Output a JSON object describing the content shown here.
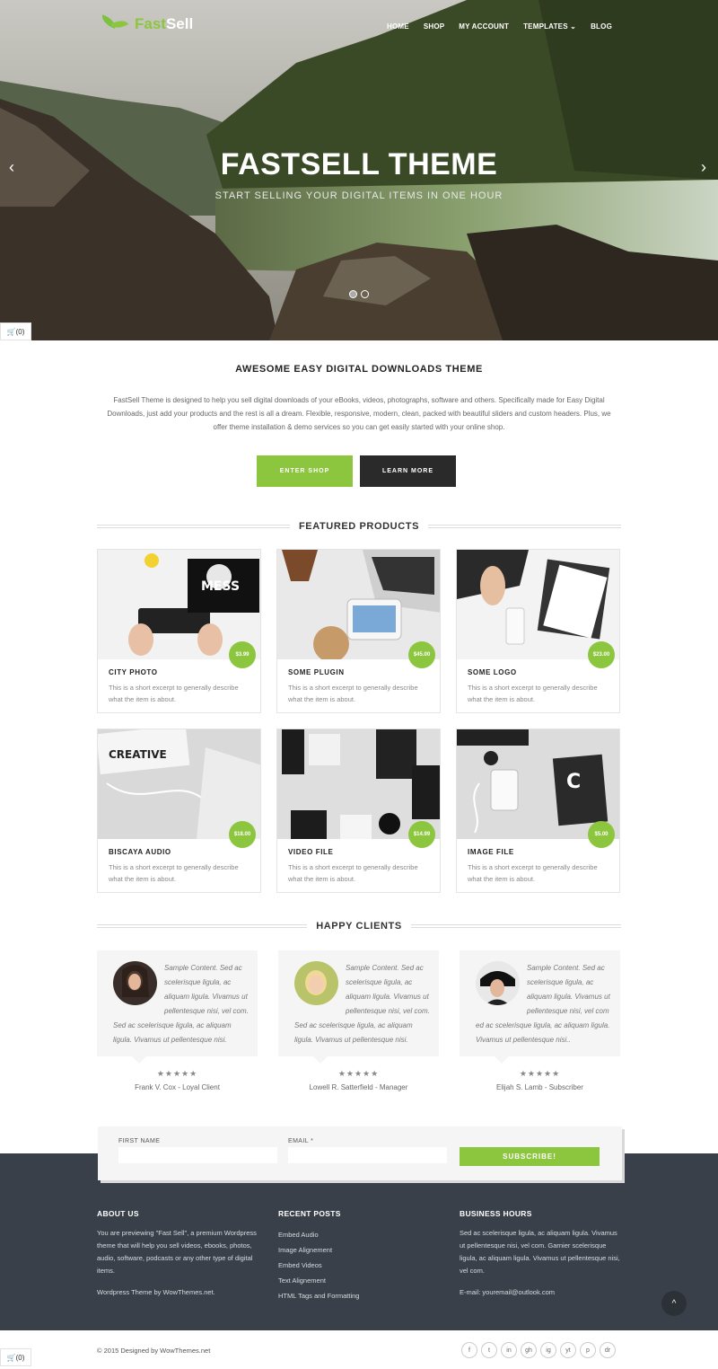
{
  "brand": {
    "logo_part1": "Fast",
    "logo_part2": "Sell"
  },
  "nav": {
    "items": [
      "HOME",
      "SHOP",
      "MY ACCOUNT",
      "TEMPLATES",
      "BLOG"
    ],
    "templates_chevron": "⌄"
  },
  "hero": {
    "title": "FASTSELL THEME",
    "subtitle": "START SELLING YOUR DIGITAL ITEMS IN ONE HOUR",
    "prev": "‹",
    "next": "›"
  },
  "cart": {
    "label": "(0)"
  },
  "intro": {
    "title": "AWESOME EASY DIGITAL DOWNLOADS THEME",
    "text": "FastSell Theme is designed to help you sell digital downloads of your eBooks, videos, photographs, software and others. Specifically made for Easy Digital Downloads, just add your products and the rest is all a dream. Flexible, responsive, modern, clean, packed with beautiful sliders and custom headers. Plus, we offer theme installation & demo services so you can get easily started with your online shop.",
    "enter_shop": "ENTER SHOP",
    "learn_more": "LEARN MORE"
  },
  "featured": {
    "title": "FEATURED PRODUCTS",
    "products": [
      {
        "name": "CITY PHOTO",
        "price": "$3.99",
        "desc": "This is a short excerpt to generally describe what the item is about."
      },
      {
        "name": "SOME PLUGIN",
        "price": "$45.00",
        "desc": "This is a short excerpt to generally describe what the item is about."
      },
      {
        "name": "SOME LOGO",
        "price": "$23.00",
        "desc": "This is a short excerpt to generally describe what the item is about."
      },
      {
        "name": "BISCAYA AUDIO",
        "price": "$18.00",
        "desc": "This is a short excerpt to generally describe what the item is about."
      },
      {
        "name": "VIDEO FILE",
        "price": "$14.99",
        "desc": "This is a short excerpt to generally describe what the item is about."
      },
      {
        "name": "IMAGE FILE",
        "price": "$5.00",
        "desc": "This is a short excerpt to generally describe what the item is about."
      }
    ]
  },
  "clients": {
    "title": "HAPPY CLIENTS",
    "items": [
      {
        "text": "Sample Content. Sed ac scelerisque ligula, ac aliquam ligula. Vivamus ut pellentesque nisi, vel com. Sed ac scelerisque ligula, ac aliquam ligula. Vivamus ut pellentesque nisi.",
        "stars": "★★★★★",
        "name": "Frank V. Cox - Loyal Client"
      },
      {
        "text": "Sample Content. Sed ac scelerisque ligula, ac aliquam ligula. Vivamus ut pellentesque nisi, vel com. Sed ac scelerisque ligula, ac aliquam ligula. Vivamus ut pellentesque nisi.",
        "stars": "★★★★★",
        "name": "Lowell R. Satterfield - Manager"
      },
      {
        "text": "Sample Content. Sed ac scelerisque ligula, ac aliquam ligula. Vivamus ut pellentesque nisi, vel com ed ac scelerisque ligula, ac aliquam ligula. Vivamus ut pellentesque nisi..",
        "stars": "★★★★★",
        "name": "Elijah S. Lamb - Subscriber"
      }
    ]
  },
  "subscribe": {
    "first_name_label": "FIRST NAME",
    "email_label": "EMAIL *",
    "button": "SUBSCRIBE!"
  },
  "footer": {
    "about_title": "ABOUT US",
    "about_text": "You are previewing \"Fast Sell\", a premium Wordpress theme that will help you sell videos, ebooks, photos, audio, software, podcasts or any other type of digital items.",
    "about_credit": "Wordpress Theme by WowThemes.net.",
    "posts_title": "RECENT POSTS",
    "posts": [
      "Embed Audio",
      "Image Alignement",
      "Embed Videos",
      "Text Alignement",
      "HTML Tags and Formatting"
    ],
    "hours_title": "BUSINESS HOURS",
    "hours_text": "Sed ac scelerisque ligula, ac aliquam ligula. Vivamus ut pellentesque nisi, vel com. Garnier scelerisque ligula, ac aliquam ligula. Vivamus ut pellentesque nisi, vel com.",
    "email": "E-mail: youremail@outlook.com",
    "to_top": "^",
    "copyright": "© 2015 Designed by WowThemes.net",
    "social": [
      "f",
      "t",
      "in",
      "gh",
      "ig",
      "yt",
      "p",
      "dr"
    ]
  },
  "colors": {
    "accent": "#8cc63f",
    "dark": "#2a2a2a",
    "footer": "#3a4049"
  }
}
